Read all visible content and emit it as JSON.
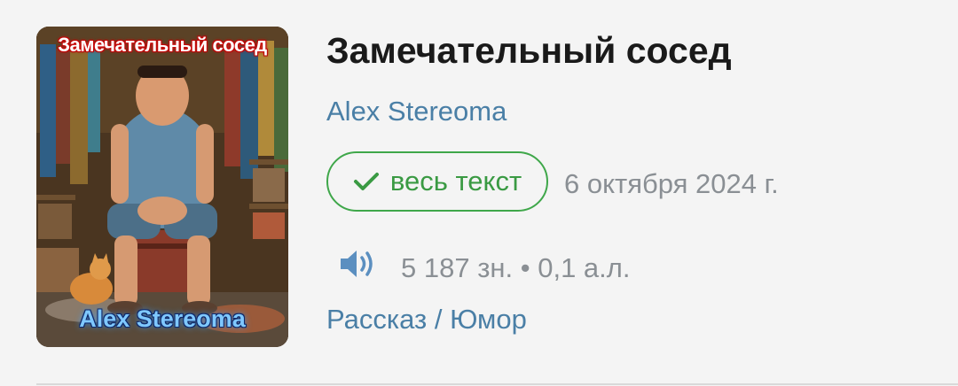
{
  "story": {
    "title": "Замечательный сосед",
    "author": "Alex Stereoma",
    "badge_label": "весь текст",
    "date": "6 октября 2024 г.",
    "stats": "5 187 зн. • 0,1 а.л.",
    "genre": "Рассказ / Юмор"
  },
  "cover": {
    "title_text": "Замечательный сосед",
    "author_text": "Alex Stereoma"
  },
  "icons": {
    "badge_icon": "check-icon",
    "audio_icon": "speaker-icon"
  },
  "colors": {
    "link": "#4a7fa6",
    "badge_green": "#3fa74a",
    "muted": "#8a8f94",
    "title": "#1a1a1a",
    "speaker": "#5b8fc0"
  }
}
